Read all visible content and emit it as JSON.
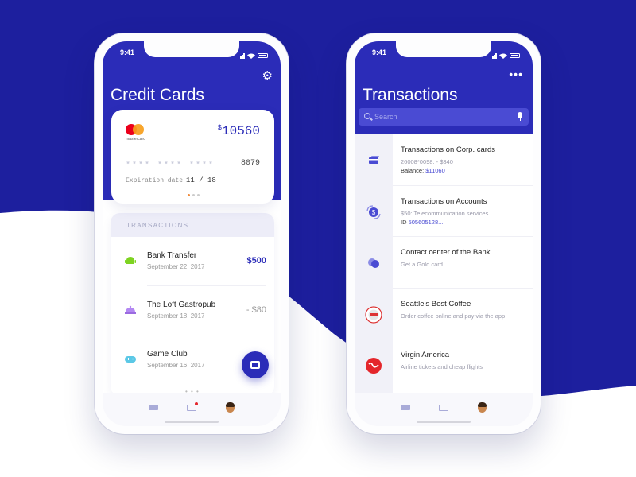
{
  "colors": {
    "brand": "#2b2cb8",
    "background_blue": "#1d1f9e",
    "accent_red": "#e4262b"
  },
  "phone_left": {
    "status_time": "9:41",
    "title": "Credit Cards",
    "card": {
      "brand_label": "mastercard",
      "currency": "$",
      "balance": "10560",
      "masked_number": "**** **** ****",
      "last_digits": "8079",
      "expiration_label": "Expiration date",
      "expiration_value": "11 / 18"
    },
    "transactions": {
      "header": "TRANSACTIONS",
      "items": [
        {
          "name": "Bank Transfer",
          "date": "September 22, 2017",
          "amount": "$500",
          "icon": "android-icon"
        },
        {
          "name": "The Loft Gastropub",
          "date": "September 18, 2017",
          "amount": "- $80",
          "icon": "cloche-icon"
        },
        {
          "name": "Game Club",
          "date": "September 16, 2017",
          "amount": "- $",
          "icon": "gamepad-icon"
        }
      ]
    },
    "tabs": [
      {
        "icon": "card-icon"
      },
      {
        "icon": "mail-icon"
      },
      {
        "icon": "avatar"
      }
    ]
  },
  "phone_right": {
    "status_time": "9:41",
    "title": "Transactions",
    "search_placeholder": "Search",
    "items": [
      {
        "title": "Transactions on Corp. cards",
        "subtitle": "26008*0098: - $340",
        "extra_label": "Balance: ",
        "extra_value": "$11060",
        "icon": "cards-icon"
      },
      {
        "title": "Transactions on Accounts",
        "subtitle": "$50: Telecommunication services",
        "extra_label": "ID ",
        "extra_value": "505605128...",
        "icon": "dollar-exchange-icon"
      },
      {
        "title": "Contact center of the Bank",
        "subtitle": "Get a Gold card",
        "icon": "chat-icon"
      },
      {
        "title": "Seattle's Best Coffee",
        "subtitle": "Order coffee online and pay via the app",
        "icon": "coffee-logo"
      },
      {
        "title": "Virgin America",
        "subtitle": "Airline tickets and cheap flights",
        "icon": "virgin-logo"
      }
    ]
  }
}
